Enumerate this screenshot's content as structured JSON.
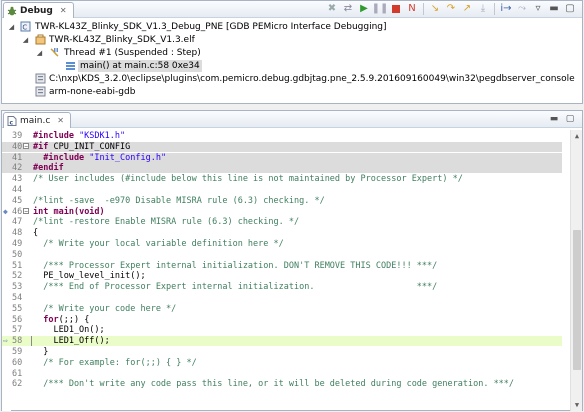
{
  "debug_view": {
    "tab_label": "Debug",
    "tree": [
      {
        "text": "TWR-KL43Z_Blinky_SDK_V1.3_Debug_PNE [GDB PEMicro Interface Debugging]",
        "icon": "launch-config-icon"
      },
      {
        "text": "TWR-KL43Z_Blinky_SDK_V1.3.elf",
        "icon": "elf-process-icon"
      },
      {
        "text": "Thread #1 (Suspended : Step)",
        "icon": "thread-suspended-icon"
      },
      {
        "text": "main() at main.c:58 0xe34",
        "icon": "stack-frame-icon"
      },
      {
        "text": "C:\\nxp\\KDS_3.2.0\\eclipse\\plugins\\com.pemicro.debug.gdbjtag.pne_2.5.9.201609160049\\win32\\pegdbserver_console",
        "icon": "gdb-server-icon"
      },
      {
        "text": "arm-none-eabi-gdb",
        "icon": "gdb-icon"
      }
    ]
  },
  "editor": {
    "tab_label": "main.c",
    "lines": [
      {
        "n": "39",
        "tokens": [
          {
            "t": "#include ",
            "c": "pp"
          },
          {
            "t": "\"KSDK1.h\"",
            "c": "str"
          }
        ]
      },
      {
        "n": "40",
        "fold": "minus",
        "inactive": true,
        "tokens": [
          {
            "t": "#if",
            "c": "pp"
          },
          {
            "t": " CPU_INIT_CONFIG",
            "c": ""
          }
        ]
      },
      {
        "n": "41",
        "inactive": true,
        "tokens": [
          {
            "t": "  #include ",
            "c": "pp"
          },
          {
            "t": "\"Init_Config.h\"",
            "c": "str"
          }
        ]
      },
      {
        "n": "42",
        "inactive": true,
        "tokens": [
          {
            "t": "#endif",
            "c": "pp"
          }
        ]
      },
      {
        "n": "43",
        "tokens": [
          {
            "t": "/* User includes (#include below this line is not maintained by Processor Expert) */",
            "c": "cmt"
          }
        ]
      },
      {
        "n": "44",
        "tokens": []
      },
      {
        "n": "45",
        "tokens": [
          {
            "t": "/*lint -save  -e970 Disable MISRA rule (6.3) checking. */",
            "c": "cmt"
          }
        ]
      },
      {
        "n": "46",
        "fold": "minus",
        "tokens": [
          {
            "t": "int",
            "c": "kw"
          },
          {
            "t": " ",
            "c": ""
          },
          {
            "t": "main(void)",
            "c": "kw"
          }
        ]
      },
      {
        "n": "47",
        "tokens": [
          {
            "t": "/*lint -restore Enable MISRA rule (6.3) checking. */",
            "c": "cmt"
          }
        ]
      },
      {
        "n": "48",
        "tokens": [
          {
            "t": "{",
            "c": ""
          }
        ]
      },
      {
        "n": "49",
        "tokens": [
          {
            "t": "  /* Write your local variable definition here */",
            "c": "cmt"
          }
        ]
      },
      {
        "n": "50",
        "tokens": []
      },
      {
        "n": "51",
        "tokens": [
          {
            "t": "  /*** Processor Expert internal initialization. DON'T REMOVE THIS CODE!!! ***/",
            "c": "cmt"
          }
        ]
      },
      {
        "n": "52",
        "tokens": [
          {
            "t": "  PE_low_level_init();",
            "c": ""
          }
        ]
      },
      {
        "n": "53",
        "tokens": [
          {
            "t": "  /*** End of Processor Expert internal initialization.                    ***/",
            "c": "cmt"
          }
        ]
      },
      {
        "n": "54",
        "tokens": []
      },
      {
        "n": "55",
        "tokens": [
          {
            "t": "  /* Write your code here */",
            "c": "cmt"
          }
        ]
      },
      {
        "n": "56",
        "tokens": [
          {
            "t": "  ",
            "c": ""
          },
          {
            "t": "for",
            "c": "kw"
          },
          {
            "t": "(;;) {",
            "c": ""
          }
        ]
      },
      {
        "n": "57",
        "tokens": [
          {
            "t": "    LED1_On();",
            "c": ""
          }
        ]
      },
      {
        "n": "58",
        "current": true,
        "tokens": [
          {
            "t": "    LED1_Off();",
            "c": ""
          }
        ]
      },
      {
        "n": "59",
        "tokens": [
          {
            "t": "  }",
            "c": ""
          }
        ]
      },
      {
        "n": "60",
        "tokens": [
          {
            "t": "  /* For example: for(;;) { } */",
            "c": "cmt"
          }
        ]
      },
      {
        "n": "61",
        "tokens": []
      },
      {
        "n": "62",
        "tokens": [
          {
            "t": "  /*** Don't write any code pass this line, or it will be deleted during code generation. ***/",
            "c": "cmt"
          }
        ]
      }
    ]
  }
}
